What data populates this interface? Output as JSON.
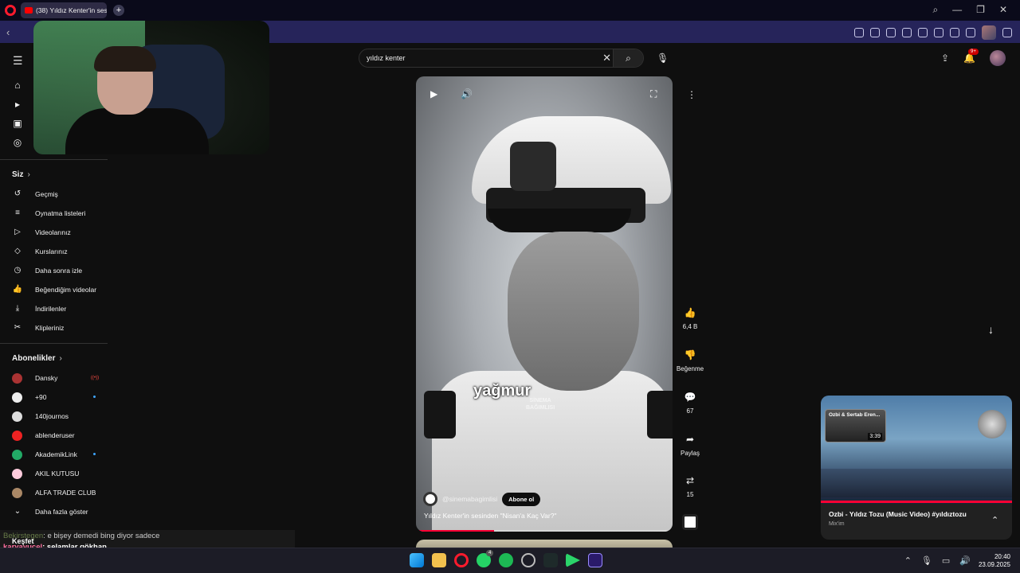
{
  "browser": {
    "tab_title": "(38) Yıldız Kenter'in sesind",
    "new_tab": "+"
  },
  "search": {
    "query": "yıldız kenter"
  },
  "notifications": {
    "badge": "9+"
  },
  "sidebar": {
    "you_title": "Siz",
    "you_items": [
      {
        "label": "Geçmiş",
        "icon": "history-icon"
      },
      {
        "label": "Oynatma listeleri",
        "icon": "playlist-icon"
      },
      {
        "label": "Videolarınız",
        "icon": "your-videos-icon"
      },
      {
        "label": "Kurslarınız",
        "icon": "courses-icon"
      },
      {
        "label": "Daha sonra izle",
        "icon": "watch-later-icon"
      },
      {
        "label": "Beğendiğim videolar",
        "icon": "liked-videos-icon"
      },
      {
        "label": "İndirilenler",
        "icon": "downloads-icon"
      },
      {
        "label": "Klipleriniz",
        "icon": "clips-icon"
      }
    ],
    "subs_title": "Abonelikler",
    "subscriptions": [
      {
        "name": "Dansky",
        "indicator": "live",
        "color": "#a33"
      },
      {
        "name": "+90",
        "indicator": "dot",
        "color": "#eee"
      },
      {
        "name": "140journos",
        "indicator": "",
        "color": "#ddd"
      },
      {
        "name": "ablenderuser",
        "indicator": "",
        "color": "#e22"
      },
      {
        "name": "AkademikLink",
        "indicator": "dot",
        "color": "#2a6"
      },
      {
        "name": "AKIL KUTUSU",
        "indicator": "",
        "color": "#fcd"
      },
      {
        "name": "ALFA TRADE CLUB",
        "indicator": "",
        "color": "#a86"
      }
    ],
    "show_more": "Daha fazla göster",
    "explore": "Keşfet"
  },
  "chat": {
    "user1": "Bekirstegen",
    "msg1": ": e bişey demedi bing diyor sadece",
    "user2": "karyayucel",
    "msg2": ": selamlar gökhan"
  },
  "short": {
    "subtitle_word": "yağmur",
    "watermark_line1": "SİNEMA",
    "watermark_line2": "BAĞIMLISI",
    "channel": "@sinemabagimlisi",
    "subscribe": "Abone ol",
    "title": "Yıldız Kenter'in sesinden \"Nisan'a Kaç Var?\"",
    "progress_percent": 30
  },
  "actions": {
    "likes": "6,4 B",
    "dislike": "Beğenme",
    "comments": "67",
    "share": "Paylaş",
    "remix": "15"
  },
  "mini_player": {
    "inset_title": "Ozbi & Sertab Eren...",
    "inset_time": "3:39",
    "title": "Ozbi - Yıldız Tozu (Music Video) #yıldıztozu",
    "subtitle": "Mix'im",
    "progress_percent": 100
  },
  "taskbar": {
    "time": "20:40",
    "date": "23.09.2025",
    "whatsapp_badge": "4"
  }
}
